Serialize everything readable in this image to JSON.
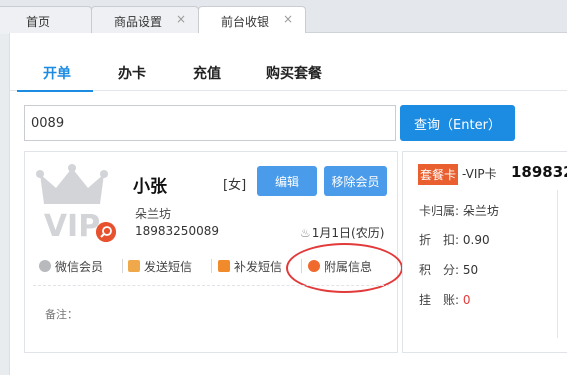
{
  "tabs": [
    {
      "label": "首页"
    },
    {
      "label": "商品设置",
      "close": "×"
    },
    {
      "label": "前台收银",
      "close": "×"
    }
  ],
  "subtabs": [
    {
      "label": "开单",
      "active": true
    },
    {
      "label": "办卡"
    },
    {
      "label": "充值"
    },
    {
      "label": "购买套餐"
    }
  ],
  "search": {
    "value": "0089",
    "button_label": "查询（Enter）"
  },
  "member": {
    "logo_text": "VIP",
    "name": "小张",
    "gender": "[女]",
    "edit_label": "编辑",
    "remove_label": "移除会员",
    "shop": "朵兰坊",
    "phone": "18983250089",
    "birthday": "1月1日(农历)",
    "actions": [
      {
        "label": "微信会员",
        "icon": "wechat-icon"
      },
      {
        "label": "发送短信",
        "icon": "sms-icon"
      },
      {
        "label": "补发短信",
        "icon": "resend-sms-icon"
      },
      {
        "label": "附属信息",
        "icon": "attachment-icon"
      }
    ],
    "note_label": "备注："
  },
  "card_info": {
    "badge": "套餐卡",
    "kind": "-VIP卡",
    "number": "189832",
    "rows": [
      {
        "label": "卡归属:",
        "value": "朵兰坊"
      },
      {
        "label": "折　扣:",
        "value": "0.90"
      },
      {
        "label": "积　分:",
        "value": "50"
      },
      {
        "label": "挂　账:",
        "value": "0"
      }
    ]
  },
  "colors": {
    "accent": "#1c8be2",
    "button": "#4a9bea",
    "badge": "#e95f2f",
    "highlight": "#e23a3a"
  }
}
